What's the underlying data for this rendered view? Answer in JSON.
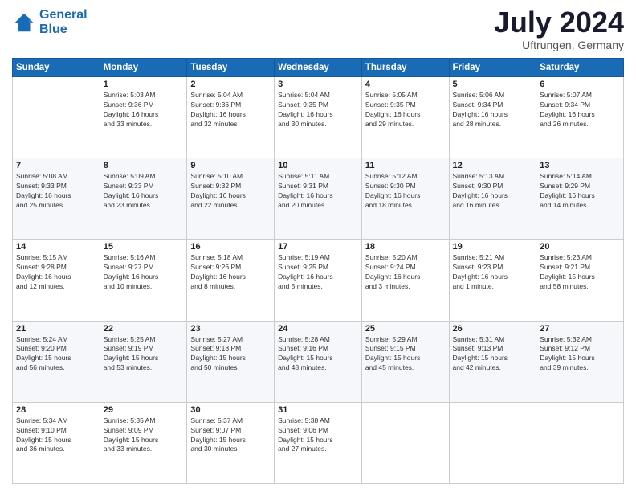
{
  "header": {
    "logo_line1": "General",
    "logo_line2": "Blue",
    "month": "July 2024",
    "location": "Uftrungen, Germany"
  },
  "days_of_week": [
    "Sunday",
    "Monday",
    "Tuesday",
    "Wednesday",
    "Thursday",
    "Friday",
    "Saturday"
  ],
  "weeks": [
    [
      {
        "day": "",
        "info": ""
      },
      {
        "day": "1",
        "info": "Sunrise: 5:03 AM\nSunset: 9:36 PM\nDaylight: 16 hours\nand 33 minutes."
      },
      {
        "day": "2",
        "info": "Sunrise: 5:04 AM\nSunset: 9:36 PM\nDaylight: 16 hours\nand 32 minutes."
      },
      {
        "day": "3",
        "info": "Sunrise: 5:04 AM\nSunset: 9:35 PM\nDaylight: 16 hours\nand 30 minutes."
      },
      {
        "day": "4",
        "info": "Sunrise: 5:05 AM\nSunset: 9:35 PM\nDaylight: 16 hours\nand 29 minutes."
      },
      {
        "day": "5",
        "info": "Sunrise: 5:06 AM\nSunset: 9:34 PM\nDaylight: 16 hours\nand 28 minutes."
      },
      {
        "day": "6",
        "info": "Sunrise: 5:07 AM\nSunset: 9:34 PM\nDaylight: 16 hours\nand 26 minutes."
      }
    ],
    [
      {
        "day": "7",
        "info": "Sunrise: 5:08 AM\nSunset: 9:33 PM\nDaylight: 16 hours\nand 25 minutes."
      },
      {
        "day": "8",
        "info": "Sunrise: 5:09 AM\nSunset: 9:33 PM\nDaylight: 16 hours\nand 23 minutes."
      },
      {
        "day": "9",
        "info": "Sunrise: 5:10 AM\nSunset: 9:32 PM\nDaylight: 16 hours\nand 22 minutes."
      },
      {
        "day": "10",
        "info": "Sunrise: 5:11 AM\nSunset: 9:31 PM\nDaylight: 16 hours\nand 20 minutes."
      },
      {
        "day": "11",
        "info": "Sunrise: 5:12 AM\nSunset: 9:30 PM\nDaylight: 16 hours\nand 18 minutes."
      },
      {
        "day": "12",
        "info": "Sunrise: 5:13 AM\nSunset: 9:30 PM\nDaylight: 16 hours\nand 16 minutes."
      },
      {
        "day": "13",
        "info": "Sunrise: 5:14 AM\nSunset: 9:29 PM\nDaylight: 16 hours\nand 14 minutes."
      }
    ],
    [
      {
        "day": "14",
        "info": "Sunrise: 5:15 AM\nSunset: 9:28 PM\nDaylight: 16 hours\nand 12 minutes."
      },
      {
        "day": "15",
        "info": "Sunrise: 5:16 AM\nSunset: 9:27 PM\nDaylight: 16 hours\nand 10 minutes."
      },
      {
        "day": "16",
        "info": "Sunrise: 5:18 AM\nSunset: 9:26 PM\nDaylight: 16 hours\nand 8 minutes."
      },
      {
        "day": "17",
        "info": "Sunrise: 5:19 AM\nSunset: 9:25 PM\nDaylight: 16 hours\nand 5 minutes."
      },
      {
        "day": "18",
        "info": "Sunrise: 5:20 AM\nSunset: 9:24 PM\nDaylight: 16 hours\nand 3 minutes."
      },
      {
        "day": "19",
        "info": "Sunrise: 5:21 AM\nSunset: 9:23 PM\nDaylight: 16 hours\nand 1 minute."
      },
      {
        "day": "20",
        "info": "Sunrise: 5:23 AM\nSunset: 9:21 PM\nDaylight: 15 hours\nand 58 minutes."
      }
    ],
    [
      {
        "day": "21",
        "info": "Sunrise: 5:24 AM\nSunset: 9:20 PM\nDaylight: 15 hours\nand 56 minutes."
      },
      {
        "day": "22",
        "info": "Sunrise: 5:25 AM\nSunset: 9:19 PM\nDaylight: 15 hours\nand 53 minutes."
      },
      {
        "day": "23",
        "info": "Sunrise: 5:27 AM\nSunset: 9:18 PM\nDaylight: 15 hours\nand 50 minutes."
      },
      {
        "day": "24",
        "info": "Sunrise: 5:28 AM\nSunset: 9:16 PM\nDaylight: 15 hours\nand 48 minutes."
      },
      {
        "day": "25",
        "info": "Sunrise: 5:29 AM\nSunset: 9:15 PM\nDaylight: 15 hours\nand 45 minutes."
      },
      {
        "day": "26",
        "info": "Sunrise: 5:31 AM\nSunset: 9:13 PM\nDaylight: 15 hours\nand 42 minutes."
      },
      {
        "day": "27",
        "info": "Sunrise: 5:32 AM\nSunset: 9:12 PM\nDaylight: 15 hours\nand 39 minutes."
      }
    ],
    [
      {
        "day": "28",
        "info": "Sunrise: 5:34 AM\nSunset: 9:10 PM\nDaylight: 15 hours\nand 36 minutes."
      },
      {
        "day": "29",
        "info": "Sunrise: 5:35 AM\nSunset: 9:09 PM\nDaylight: 15 hours\nand 33 minutes."
      },
      {
        "day": "30",
        "info": "Sunrise: 5:37 AM\nSunset: 9:07 PM\nDaylight: 15 hours\nand 30 minutes."
      },
      {
        "day": "31",
        "info": "Sunrise: 5:38 AM\nSunset: 9:06 PM\nDaylight: 15 hours\nand 27 minutes."
      },
      {
        "day": "",
        "info": ""
      },
      {
        "day": "",
        "info": ""
      },
      {
        "day": "",
        "info": ""
      }
    ]
  ]
}
